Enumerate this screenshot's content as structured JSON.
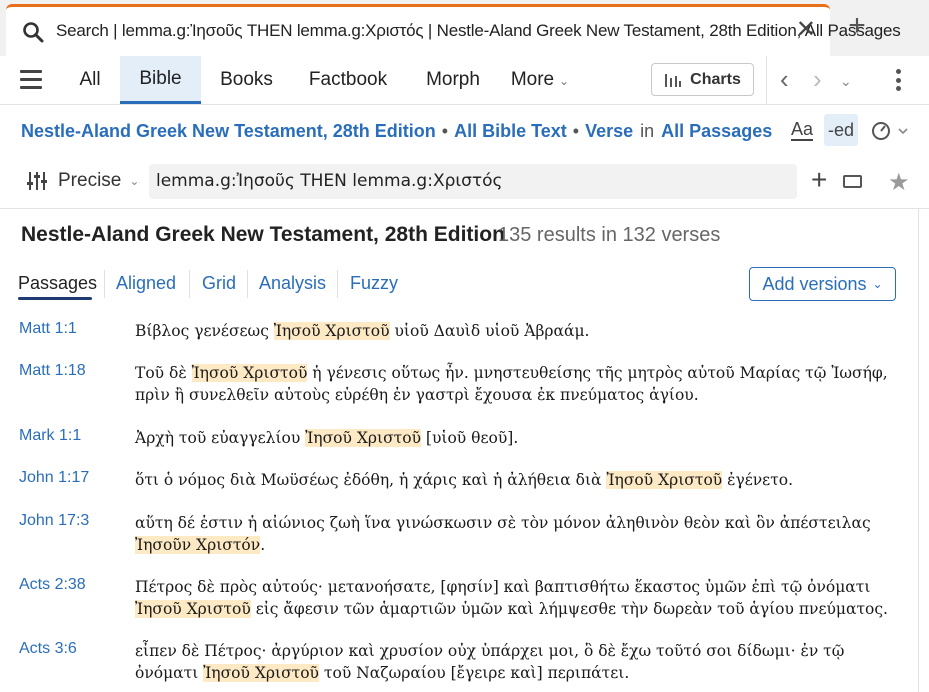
{
  "tab": {
    "title": "Search | lemma.g:Ἰησοῦς THEN lemma.g:Χριστός | Nestle-Aland Greek New Testament, 28th Edition, All Passages",
    "close_glyph": "✕",
    "new_tab_glyph": "+"
  },
  "nav": {
    "tabs": [
      "All",
      "Bible",
      "Books",
      "Factbook",
      "Morph"
    ],
    "more": "More",
    "charts": "Charts",
    "accent": "#2a6ebb"
  },
  "scope": {
    "resource": "Nestle-Aland Greek New Testament, 28th Edition",
    "text": "All Bible Text",
    "unit": "Verse",
    "in": "in",
    "range": "All Passages",
    "aa": "Aa",
    "ed": "-ed"
  },
  "search": {
    "precision": "Precise",
    "query": "lemma.g:Ἰησοῦς THEN lemma.g:Χριστός"
  },
  "results": {
    "title": "Nestle-Aland Greek New Testament, 28th Edition",
    "count": "135 results in 132 verses",
    "view_tabs": [
      "Passages",
      "Aligned",
      "Grid",
      "Analysis",
      "Fuzzy"
    ],
    "add_versions": "Add versions",
    "highlight_color": "#fde9c4"
  },
  "passages": [
    {
      "ref": "Matt 1:1",
      "parts": [
        "Βίβλος γενέσεως ",
        "Ἰησοῦ Χριστοῦ",
        " υἱοῦ Δαυὶδ υἱοῦ Ἀβραάμ."
      ]
    },
    {
      "ref": "Matt 1:18",
      "parts": [
        "Τοῦ δὲ ",
        "Ἰησοῦ Χριστοῦ",
        " ἡ γένεσις οὕτως ἦν. μνηστευθείσης τῆς μητρὸς αὐτοῦ Μαρίας τῷ Ἰωσήφ, πρὶν ἢ συνελθεῖν αὐτοὺς εὑρέθη ἐν γαστρὶ ἔχουσα ἐκ πνεύματος ἁγίου."
      ]
    },
    {
      "ref": "Mark 1:1",
      "parts": [
        "Ἀρχὴ τοῦ εὐαγγελίου ",
        "Ἰησοῦ Χριστοῦ",
        " [υἱοῦ θεοῦ]."
      ]
    },
    {
      "ref": "John 1:17",
      "parts": [
        "ὅτι ὁ νόμος διὰ Μωϋσέως ἐδόθη, ἡ χάρις καὶ ἡ ἀλήθεια διὰ ",
        "Ἰησοῦ Χριστοῦ",
        " ἐγένετο."
      ]
    },
    {
      "ref": "John 17:3",
      "parts": [
        "αὕτη δέ ἐστιν ἡ αἰώνιος ζωὴ ἵνα γινώσκωσιν σὲ τὸν μόνον ἀληθινὸν θεὸν καὶ ὃν ἀπέστειλας ",
        "Ἰησοῦν Χριστόν",
        "."
      ]
    },
    {
      "ref": "Acts 2:38",
      "parts": [
        "Πέτρος δὲ πρὸς αὐτούς· μετανοήσατε, [φησίν] καὶ βαπτισθήτω ἕκαστος ὑμῶν ἐπὶ τῷ ὀνόματι ",
        "Ἰησοῦ Χριστοῦ",
        " εἰς ἄφεσιν τῶν ἁμαρτιῶν ὑμῶν καὶ λήμψεσθε τὴν δωρεὰν τοῦ ἁγίου πνεύματος."
      ]
    },
    {
      "ref": "Acts 3:6",
      "parts": [
        "εἶπεν δὲ Πέτρος· ἀργύριον καὶ χρυσίον οὐχ ὑπάρχει μοι, ὃ δὲ ἔχω τοῦτό σοι δίδωμι· ἐν τῷ ὀνόματι ",
        "Ἰησοῦ Χριστοῦ",
        " τοῦ Ναζωραίου [ἔγειρε καὶ] περιπάτει."
      ]
    }
  ]
}
